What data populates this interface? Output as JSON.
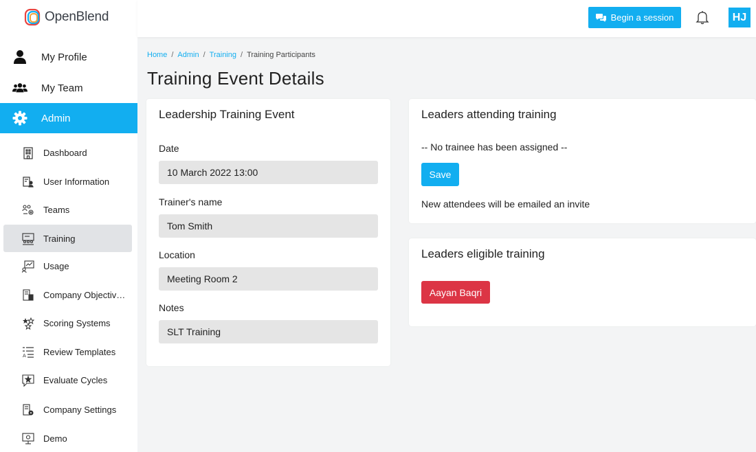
{
  "app": {
    "name": "OpenBlend"
  },
  "sidebar": {
    "main_items": [
      {
        "label": "My Profile",
        "icon": "user-icon"
      },
      {
        "label": "My Team",
        "icon": "users-icon"
      },
      {
        "label": "Admin",
        "icon": "gear-icon"
      }
    ],
    "sub_items": [
      {
        "label": "Dashboard",
        "icon": "building-icon"
      },
      {
        "label": "User Information",
        "icon": "user-info-icon"
      },
      {
        "label": "Teams",
        "icon": "teams-icon"
      },
      {
        "label": "Training",
        "icon": "training-icon"
      },
      {
        "label": "Usage",
        "icon": "usage-icon"
      },
      {
        "label": "Company Objectiv…",
        "icon": "objectives-icon"
      },
      {
        "label": "Scoring Systems",
        "icon": "stars-icon"
      },
      {
        "label": "Review Templates",
        "icon": "list-icon"
      },
      {
        "label": "Evaluate Cycles",
        "icon": "star-chat-icon"
      },
      {
        "label": "Company Settings",
        "icon": "settings-building-icon"
      },
      {
        "label": "Demo",
        "icon": "monitor-icon"
      }
    ],
    "active_main": "Admin",
    "active_sub": "Training"
  },
  "topbar": {
    "session_button": "Begin a session",
    "avatar_initials": "HJ"
  },
  "breadcrumb": {
    "items": [
      "Home",
      "Admin",
      "Training",
      "Training Participants"
    ],
    "separator": "/"
  },
  "page": {
    "title": "Training Event Details"
  },
  "event_card": {
    "title": "Leadership Training Event",
    "fields": [
      {
        "label": "Date",
        "value": "10 March 2022 13:00"
      },
      {
        "label": "Trainer's name",
        "value": "Tom Smith"
      },
      {
        "label": "Location",
        "value": "Meeting Room 2"
      },
      {
        "label": "Notes",
        "value": "SLT Training"
      }
    ]
  },
  "attending_card": {
    "title": "Leaders attending training",
    "empty_text": "-- No trainee has been assigned --",
    "save_label": "Save",
    "note": "New attendees will be emailed an invite"
  },
  "eligible_card": {
    "title": "Leaders eligible training",
    "leaders": [
      "Aayan Baqri"
    ]
  },
  "colors": {
    "accent": "#12aef0",
    "danger": "#dc3545",
    "field_bg": "#e5e5e5",
    "page_bg": "#f3f4f5"
  }
}
